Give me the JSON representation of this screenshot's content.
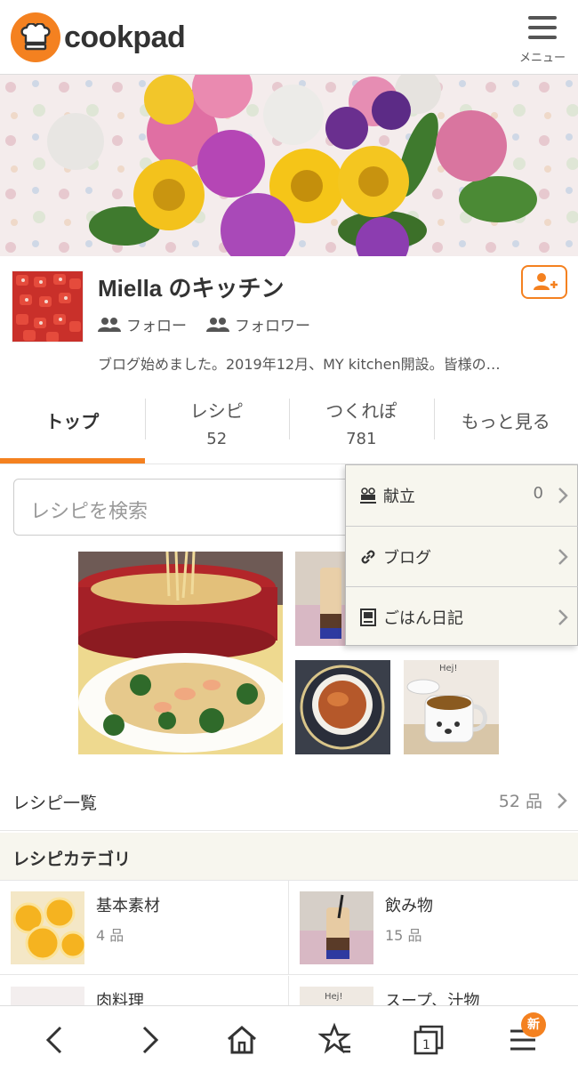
{
  "header": {
    "logo_text": "cookpad",
    "menu_label": "メニュー"
  },
  "profile": {
    "kitchen_name": "Miella のキッチン",
    "follow_label": "フォロー",
    "follower_label": "フォロワー",
    "bio": "ブログ始めました。2019年12月、MY kitchen開設。皆様の…"
  },
  "tabs": [
    {
      "label": "トップ",
      "count": ""
    },
    {
      "label": "レシピ",
      "count": "52"
    },
    {
      "label": "つくれぽ",
      "count": "781"
    },
    {
      "label": "もっと見る",
      "count": ""
    }
  ],
  "search": {
    "placeholder": "レシピを検索"
  },
  "dropdown": [
    {
      "label": "献立",
      "count": "0",
      "icon": "menu-plan-icon"
    },
    {
      "label": "ブログ",
      "count": "",
      "icon": "link-icon"
    },
    {
      "label": "ごはん日記",
      "count": "",
      "icon": "diary-icon"
    }
  ],
  "recipe_list": {
    "label": "レシピ一覧",
    "count": "52 品"
  },
  "categories": {
    "header": "レシピカテゴリ",
    "items": [
      {
        "name": "基本素材",
        "count": "4 品"
      },
      {
        "name": "飲み物",
        "count": "15 品"
      },
      {
        "name": "肉料理",
        "count": ""
      },
      {
        "name": "スープ、汁物",
        "count": ""
      }
    ]
  },
  "bottom_nav": {
    "badge": "新"
  },
  "colors": {
    "accent": "#F48120"
  }
}
